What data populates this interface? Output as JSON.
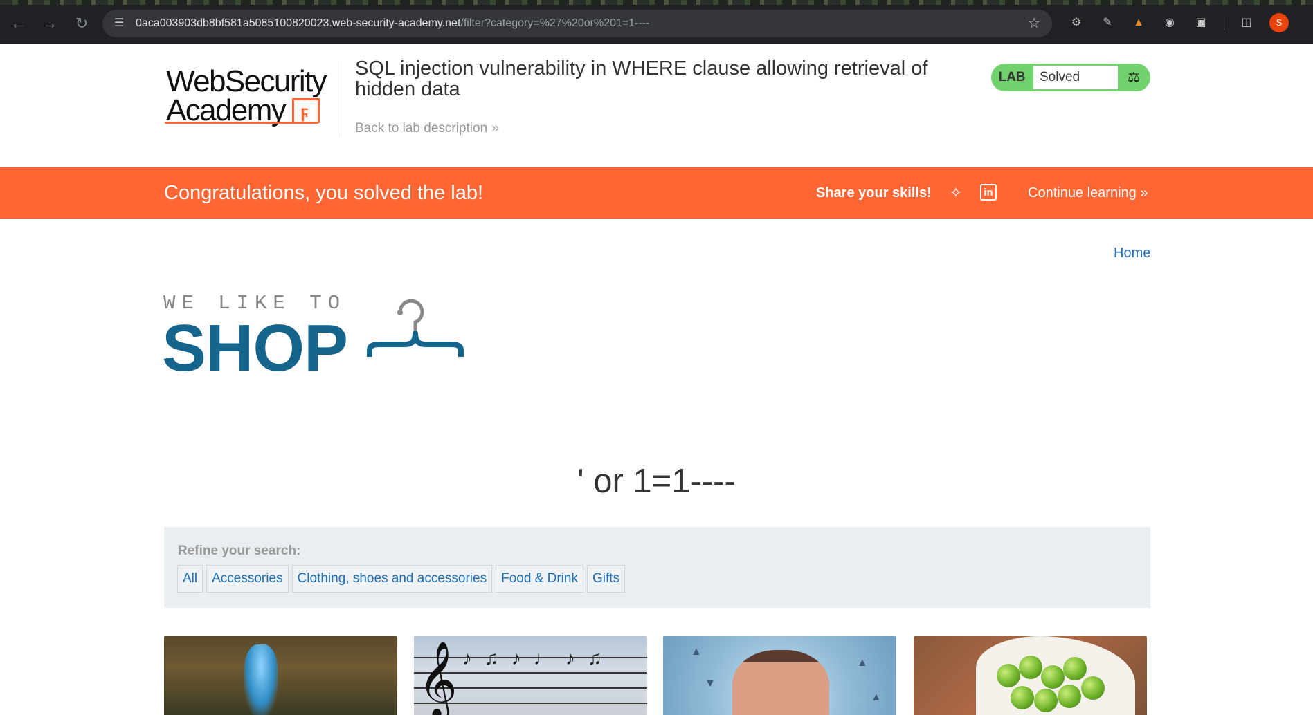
{
  "browser": {
    "url_host": "0aca003903db8bf581a5085100820023.web-security-academy.net",
    "url_path": "/filter?category=%27%20or%201=1----",
    "profile_initial": "S"
  },
  "header": {
    "logo_line1": "WebSecurity",
    "logo_line2": "Academy",
    "lab_title": "SQL injection vulnerability in WHERE clause allowing retrieval of hidden data",
    "back_link": "Back to lab description",
    "lab_tag": "LAB",
    "lab_status": "Solved"
  },
  "banner": {
    "message": "Congratulations, you solved the lab!",
    "share_label": "Share your skills!",
    "continue_label": "Continue learning"
  },
  "nav": {
    "home": "Home"
  },
  "shop_logo": {
    "tagline": "WE LIKE TO",
    "word": "SHOP"
  },
  "filter": {
    "heading": "' or 1=1----",
    "refine_label": "Refine your search:",
    "categories": [
      "All",
      "Accessories",
      "Clothing, shoes and accessories",
      "Food & Drink",
      "Gifts"
    ]
  },
  "colors": {
    "accent_orange": "#ff6633",
    "lab_green": "#70d16d",
    "link_blue": "#1f6fb5",
    "shop_blue": "#14648b"
  }
}
